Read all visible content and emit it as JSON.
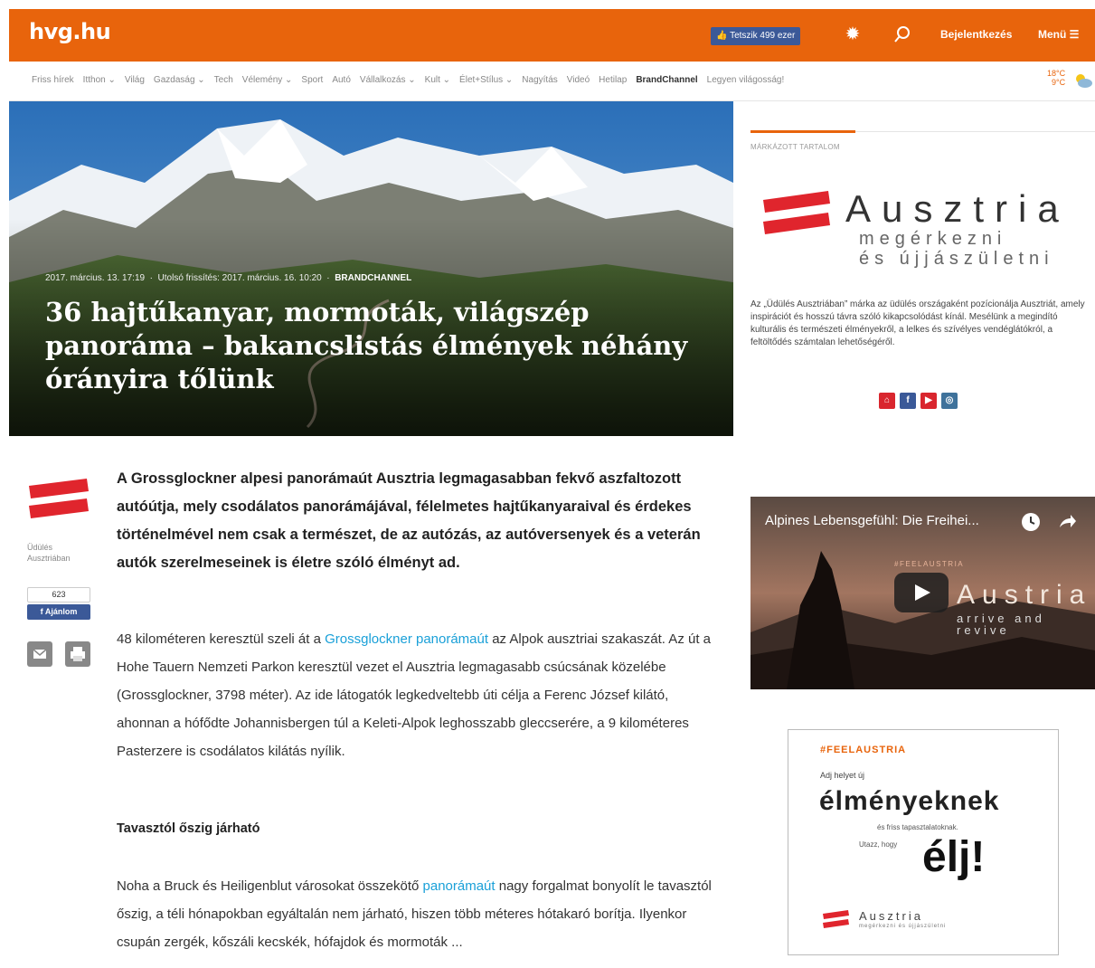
{
  "header": {
    "logo": "hvg.hu",
    "like_label": "Tetszik 499 ezer",
    "login_label": "Bejelentkezés",
    "menu_label": "Menü ☰",
    "brand_color": "#e8640c"
  },
  "nav": {
    "items": [
      "Friss hírek",
      "Itthon ⌄",
      "Világ",
      "Gazdaság ⌄",
      "Tech",
      "Vélemény ⌄",
      "Sport",
      "Autó",
      "Vállalkozás ⌄",
      "Kult ⌄",
      "Élet+Stílus ⌄",
      "Nagyítás",
      "Videó",
      "Hetilap",
      "BrandChannel",
      "Legyen világosság!"
    ],
    "active_index": 14,
    "weather_high": "18°C",
    "weather_low": "9°C"
  },
  "hero": {
    "meta_date": "2017. március. 13. 17:19",
    "meta_updated": "Utolsó frissítés: 2017. március. 16. 10:20",
    "meta_channel": "BRANDCHANNEL",
    "title": "36 hajtűkanyar, mormoták, világszép panoráma – bakancslistás élmények néhány órányira tőlünk"
  },
  "sidebar": {
    "brand_label": "MÁRKÁZOTT TARTALOM",
    "logo_word": "Ausztria",
    "logo_sub1": "megérkezni",
    "logo_sub2": "és újjászületni",
    "description": "Az „Üdülés Ausztriában” márka az üdülés országaként pozícionálja Ausztriát, amely inspirációt és hosszú távra szóló kikapcsolódást kínál. Mesélünk a megindító kulturális és természeti élményekről, a lelkes és szívélyes vendéglátókról, a feltöltődés számtalan lehetőségéről.",
    "video_title": "Alpines Lebensgefühl: Die Freihei...",
    "video_tag": "#FEELAUSTRIA",
    "video_brand": "Austria",
    "video_sub": "arrive and revive",
    "ad_tag": "#FEELAUSTRIA",
    "ad_line1": "Adj helyet új",
    "ad_big": "élményeknek",
    "ad_line2": "és friss tapasztalatoknak.",
    "ad_line3": "Utazz, hogy",
    "ad_elj": "élj!",
    "ad_logo": "Ausztria",
    "ad_logo_sub": "megérkezni és újjászületni"
  },
  "author": {
    "name": "Üdülés Ausztriában",
    "like_count": "623",
    "like_label": "Ajánlom"
  },
  "article": {
    "lead": "A Grossglockner alpesi panorámaút Ausztria legmagasabban fekvő aszfaltozott autóútja, mely csodálatos panorámájával, félelmetes hajtűkanyaraival és érdekes történelmével nem csak a természet, de az autózás, az autóversenyek és a veterán autók szerelmeseinek is életre szóló élményt ad.",
    "p1_a": "48 kilométeren keresztül szeli át a ",
    "p1_link": "Grossglockner panorámaút",
    "p1_b": " az Alpok ausztriai szakaszát. Az út a Hohe Tauern Nemzeti Parkon keresztül vezet el Ausztria legmagasabb csúcsának közelébe (Grossglockner, 3798 méter). Az ide látogatók legkedveltebb úti célja a Ferenc József kilátó, ahonnan a hófődte Johannisbergen túl a Keleti-Alpok leghosszabb gleccserére, a 9 kilométeres Pasterzere is csodálatos kilátás nyílik.",
    "subhead": "Tavasztól őszig járható",
    "p2_a": "Noha a Bruck és Heiligenblut városokat összekötő ",
    "p2_link": "panorámaút",
    "p2_b": " nagy forgalmat bonyolít le tavasztól őszig, a téli hónapokban egyáltalán nem járható, hiszen több méteres hótakaró borítja. Ilyenkor csupán zergék, kőszáli kecskék, hófajdok és mormoták ..."
  }
}
